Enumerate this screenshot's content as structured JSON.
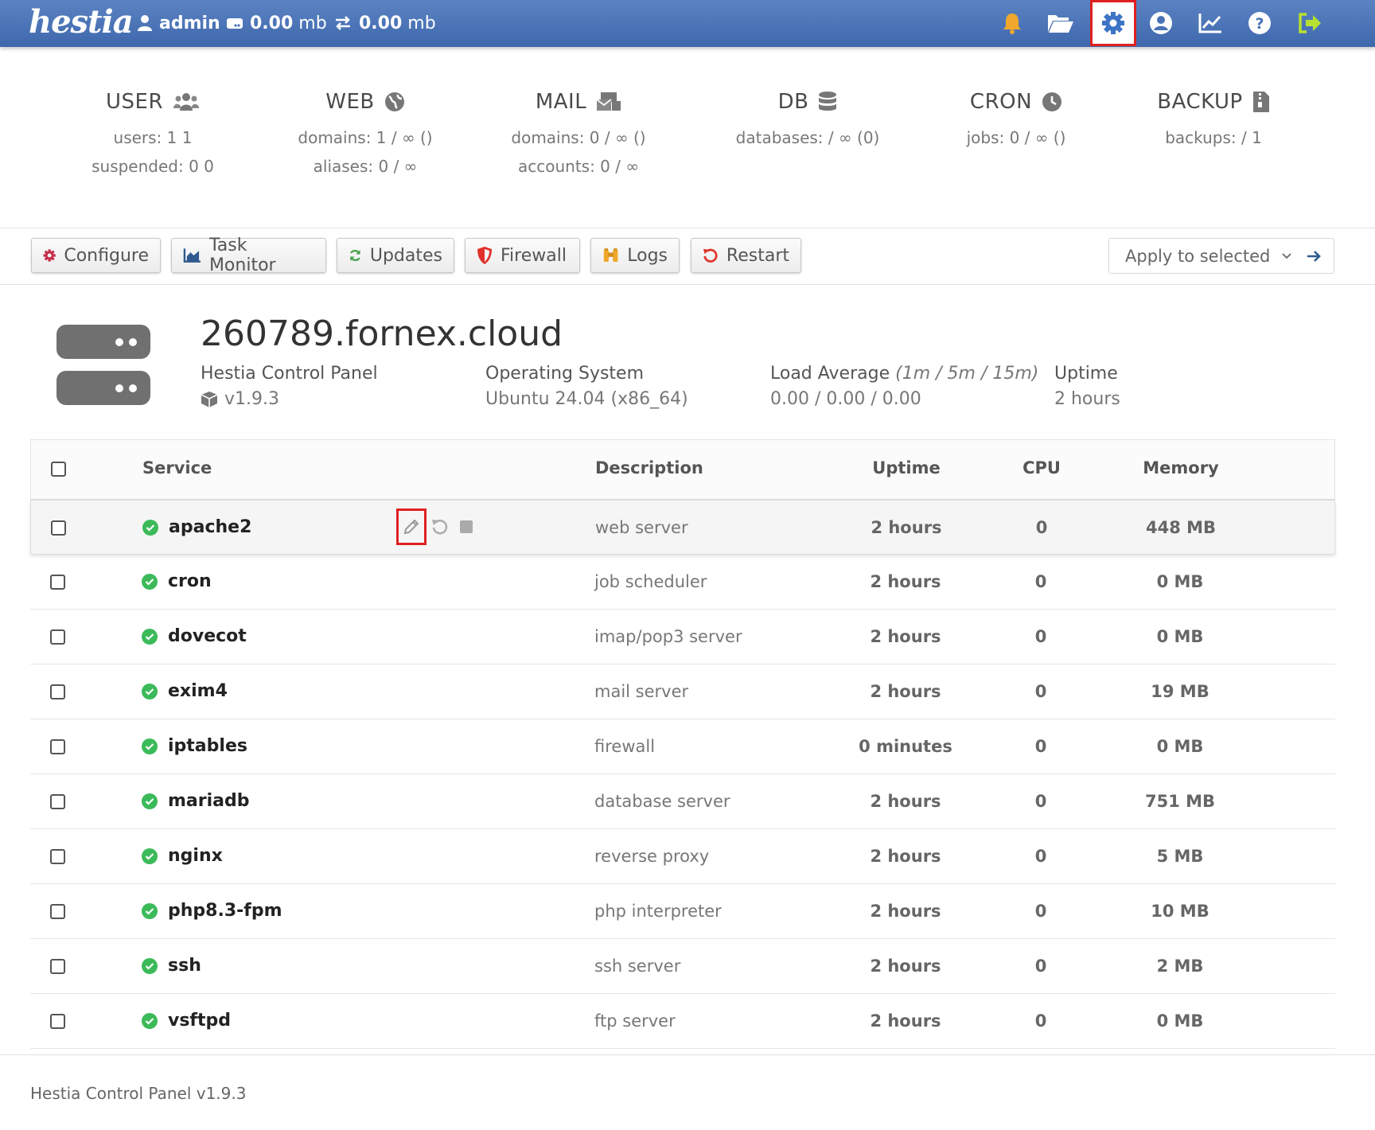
{
  "topbar": {
    "logo": "hestia",
    "user": "admin",
    "disk_value": "0.00",
    "disk_unit": "mb",
    "bandwidth_value": "0.00",
    "bandwidth_unit": "mb",
    "icons": [
      "bell-icon",
      "folder-icon",
      "gear-icon",
      "user-circle-icon",
      "chart-icon",
      "help-icon",
      "logout-icon"
    ],
    "colors": {
      "bar": "#4a72b6",
      "bell": "#f0a82c",
      "active_border": "#e02020",
      "logout": "#b8e030"
    }
  },
  "stats": [
    {
      "title": "USER",
      "lines": [
        "users: 1 1",
        "suspended: 0 0"
      ]
    },
    {
      "title": "WEB",
      "lines": [
        "domains: 1 / ∞ ()",
        "aliases: 0 / ∞"
      ]
    },
    {
      "title": "MAIL",
      "lines": [
        "domains: 0 / ∞ ()",
        "accounts: 0 / ∞"
      ]
    },
    {
      "title": "DB",
      "lines": [
        "databases: / ∞ (0)"
      ]
    },
    {
      "title": "CRON",
      "lines": [
        "jobs: 0 / ∞ ()"
      ]
    },
    {
      "title": "BACKUP",
      "lines": [
        "backups: / 1"
      ]
    }
  ],
  "toolbar": {
    "configure": "Configure",
    "task_monitor": "Task Monitor",
    "updates": "Updates",
    "firewall": "Firewall",
    "logs": "Logs",
    "restart": "Restart",
    "apply": "Apply to selected"
  },
  "server": {
    "hostname": "260789.fornex.cloud",
    "panel_label": "Hestia Control Panel",
    "panel_version": "v1.9.3",
    "os_label": "Operating System",
    "os_value": "Ubuntu 24.04 (x86_64)",
    "load_label": "Load Average",
    "load_sub": "(1m / 5m / 15m)",
    "load_value": "0.00 / 0.00 / 0.00",
    "uptime_label": "Uptime",
    "uptime_value": "2 hours"
  },
  "table": {
    "headers": {
      "service": "Service",
      "description": "Description",
      "uptime": "Uptime",
      "cpu": "CPU",
      "memory": "Memory"
    },
    "rows": [
      {
        "service": "apache2",
        "description": "web server",
        "uptime": "2 hours",
        "cpu": "0",
        "memory": "448 MB"
      },
      {
        "service": "cron",
        "description": "job scheduler",
        "uptime": "2 hours",
        "cpu": "0",
        "memory": "0 MB"
      },
      {
        "service": "dovecot",
        "description": "imap/pop3 server",
        "uptime": "2 hours",
        "cpu": "0",
        "memory": "0 MB"
      },
      {
        "service": "exim4",
        "description": "mail server",
        "uptime": "2 hours",
        "cpu": "0",
        "memory": "19 MB"
      },
      {
        "service": "iptables",
        "description": "firewall",
        "uptime": "0 minutes",
        "cpu": "0",
        "memory": "0 MB"
      },
      {
        "service": "mariadb",
        "description": "database server",
        "uptime": "2 hours",
        "cpu": "0",
        "memory": "751 MB"
      },
      {
        "service": "nginx",
        "description": "reverse proxy",
        "uptime": "2 hours",
        "cpu": "0",
        "memory": "5 MB"
      },
      {
        "service": "php8.3-fpm",
        "description": "php interpreter",
        "uptime": "2 hours",
        "cpu": "0",
        "memory": "10 MB"
      },
      {
        "service": "ssh",
        "description": "ssh server",
        "uptime": "2 hours",
        "cpu": "0",
        "memory": "2 MB"
      },
      {
        "service": "vsftpd",
        "description": "ftp server",
        "uptime": "2 hours",
        "cpu": "0",
        "memory": "0 MB"
      }
    ]
  },
  "footer": {
    "text": "Hestia Control Panel v1.9.3"
  }
}
